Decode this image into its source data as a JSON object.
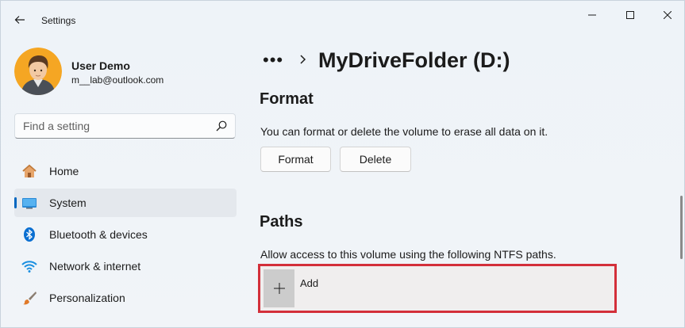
{
  "window": {
    "title": "Settings"
  },
  "profile": {
    "name": "User Demo",
    "email": "m__lab@outlook.com"
  },
  "search": {
    "placeholder": "Find a setting"
  },
  "nav": {
    "items": [
      {
        "label": "Home",
        "icon": "home-icon"
      },
      {
        "label": "System",
        "icon": "system-icon",
        "active": true
      },
      {
        "label": "Bluetooth & devices",
        "icon": "bluetooth-icon"
      },
      {
        "label": "Network & internet",
        "icon": "wifi-icon"
      },
      {
        "label": "Personalization",
        "icon": "brush-icon"
      }
    ]
  },
  "breadcrumb": {
    "overflow": "•••",
    "current": "MyDriveFolder (D:)"
  },
  "format_section": {
    "title": "Format",
    "description": "You can format or delete the volume to erase all data on it.",
    "format_button": "Format",
    "delete_button": "Delete"
  },
  "paths_section": {
    "title": "Paths",
    "description": "Allow access to this volume using the following NTFS paths.",
    "add_label": "Add"
  },
  "colors": {
    "accent": "#0067c0",
    "highlight_border": "#d32f3a"
  }
}
